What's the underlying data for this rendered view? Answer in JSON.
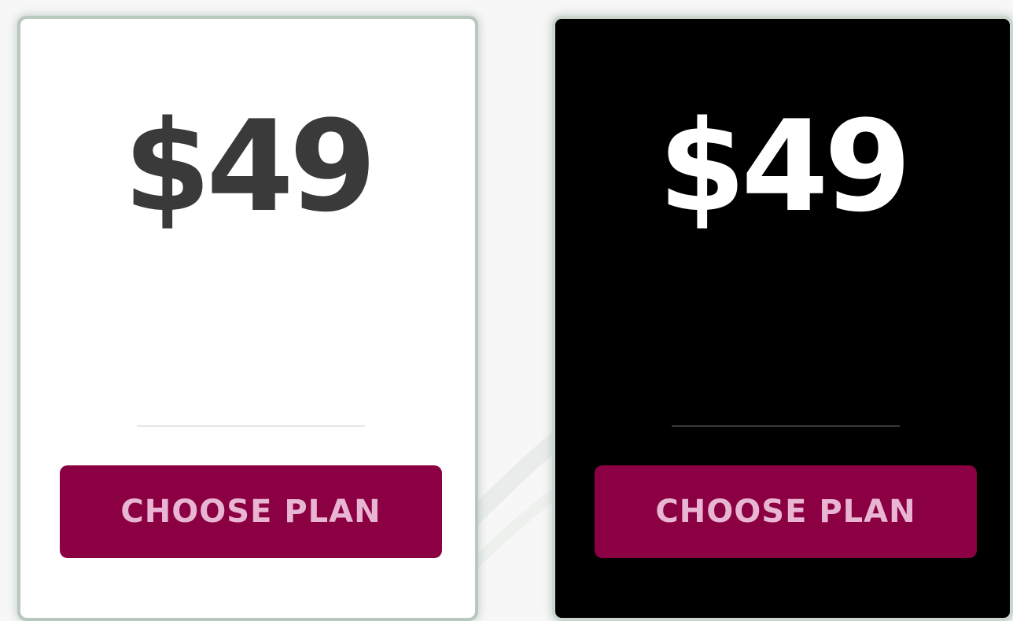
{
  "plans": [
    {
      "theme": "light",
      "price": "$49",
      "button_label": "CHOOSE PLAN"
    },
    {
      "theme": "dark",
      "price": "$49",
      "button_label": "CHOOSE PLAN"
    }
  ],
  "colors": {
    "background": "#f6f7f6",
    "light_card": "#ffffff",
    "dark_card": "#000000",
    "button": "#8b0042",
    "button_text": "#e8b6d2",
    "price_light": "#3a3a3a",
    "price_dark": "#ffffff"
  }
}
